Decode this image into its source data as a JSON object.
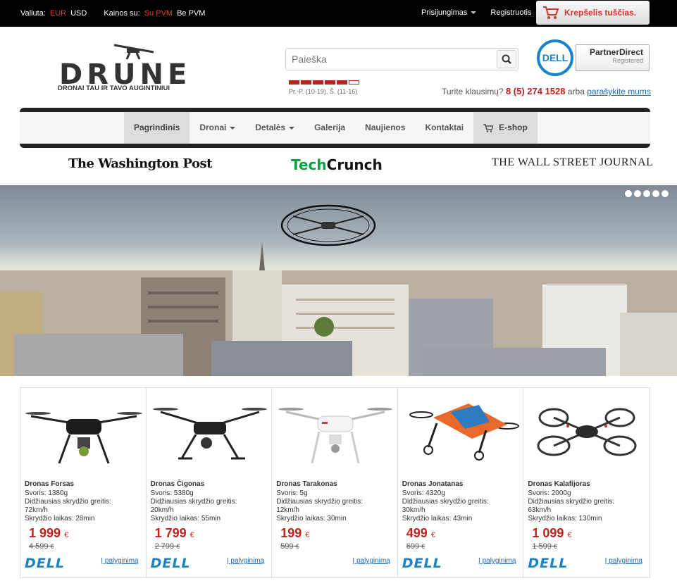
{
  "topbar": {
    "currency_label": "Valiuta:",
    "currency_eur": "EUR",
    "currency_usd": "USD",
    "price_label": "Kainos su:",
    "price_with_vat": "Su PVM",
    "price_without_vat": "Be PVM",
    "login": "Prisijungimas",
    "register": "Registruotis",
    "cart": "Krepšelis tuščias."
  },
  "logo": {
    "word": "DRUNE",
    "slogan": "DRONAI TAU IR TAVO AUGINTINIUI"
  },
  "search": {
    "placeholder": "Paieška"
  },
  "hours": {
    "text": "Pr.-P. (10-19), Š. (11-16)",
    "filled": 5,
    "total": 6
  },
  "partner": {
    "brand": "DELL",
    "line1": "PartnerDirect",
    "line2": "Registered"
  },
  "contact": {
    "question": "Turite klausimų?",
    "phone": "8 (5) 274 1528",
    "or": "arba",
    "write_link": "parašykite mums"
  },
  "nav": {
    "items": [
      {
        "label": "Pagrindinis"
      },
      {
        "label": "Dronai"
      },
      {
        "label": "Detalės"
      },
      {
        "label": "Galerija"
      },
      {
        "label": "Naujienos"
      },
      {
        "label": "Kontaktai"
      },
      {
        "label": "E-shop"
      }
    ]
  },
  "press": {
    "wp": "The Washington Post",
    "tc1": "Tech",
    "tc2": "Crunch",
    "wsj": "THE WALL STREET JOURNAL"
  },
  "hero": {
    "slides": 5
  },
  "products": [
    {
      "name": "Dronas Forsas",
      "weight": "Svoris: 1380g",
      "speed_label": "Didžiausias skrydžio greitis:",
      "speed": "72km/h",
      "time": "Skrydžio laikas: 28min",
      "price": "1 999",
      "old_price": "4 599",
      "currency": "€",
      "compare": "Į palyginimą",
      "brand": "DELL"
    },
    {
      "name": "Dronas Čigonas",
      "weight": "Svoris: 5380g",
      "speed_label": "Didžiausias skrydžio greitis:",
      "speed": "20km/h",
      "time": "Skrydžio laikas: 55min",
      "price": "1 799",
      "old_price": "2 799",
      "currency": "€",
      "compare": "Į palyginimą",
      "brand": "DELL"
    },
    {
      "name": "Dronas Tarakonas",
      "weight": "Svoris: 5g",
      "speed_label": "Didžiausias skrydžio greitis:",
      "speed": "12km/h",
      "time": "Skrydžio laikas: 30min",
      "price": "199",
      "old_price": "599",
      "currency": "€",
      "compare": "Į palyginimą",
      "brand": ""
    },
    {
      "name": "Dronas Jonatanas",
      "weight": "Svoris: 4320g",
      "speed_label": "Didžiausias skrydžio greitis:",
      "speed": "30km/h",
      "time": "Skrydžio laikas: 43min",
      "price": "499",
      "old_price": "699",
      "currency": "€",
      "compare": "Į palyginimą",
      "brand": "DELL"
    },
    {
      "name": "Dronas Kalafijoras",
      "weight": "Svoris: 2000g",
      "speed_label": "Didžiausias skrydžio greitis:",
      "speed": "63km/h",
      "time": "Skrydžio laikas: 130min",
      "price": "1 099",
      "old_price": "1 599",
      "currency": "€",
      "compare": "Į palyginimą",
      "brand": "DELL"
    }
  ]
}
